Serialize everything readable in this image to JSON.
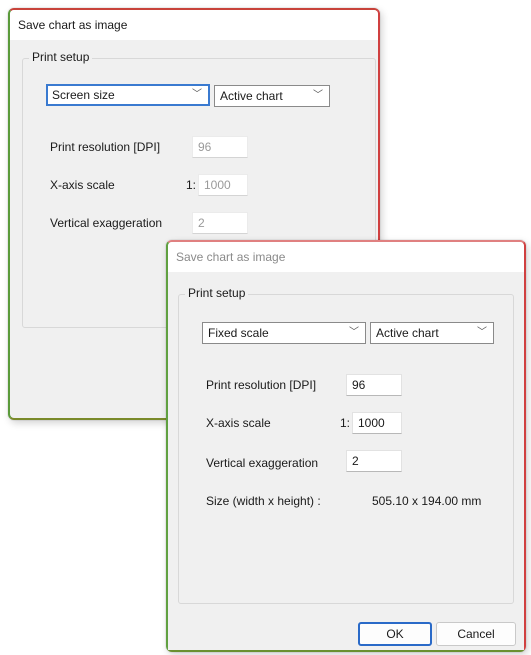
{
  "back_dialog": {
    "title": "Save chart as image",
    "group_title": "Print setup",
    "mode_value": "Screen size",
    "chart_value": "Active chart",
    "dpi_label": "Print resolution [DPI]",
    "dpi_value": "96",
    "xscale_label": "X-axis scale",
    "xscale_prefix": "1:",
    "xscale_value": "1000",
    "vexag_label": "Vertical exaggeration",
    "vexag_value": "2"
  },
  "front_dialog": {
    "title": "Save chart as image",
    "group_title": "Print setup",
    "mode_value": "Fixed scale",
    "chart_value": "Active chart",
    "dpi_label": "Print resolution [DPI]",
    "dpi_value": "96",
    "xscale_label": "X-axis scale",
    "xscale_prefix": "1:",
    "xscale_value": "1000",
    "vexag_label": "Vertical exaggeration",
    "vexag_value": "2",
    "size_label": "Size (width x height) :",
    "size_value": "505.10 x 194.00 mm",
    "ok_label": "OK",
    "cancel_label": "Cancel"
  },
  "icons": {
    "dropdown": "chevron-down-icon"
  }
}
